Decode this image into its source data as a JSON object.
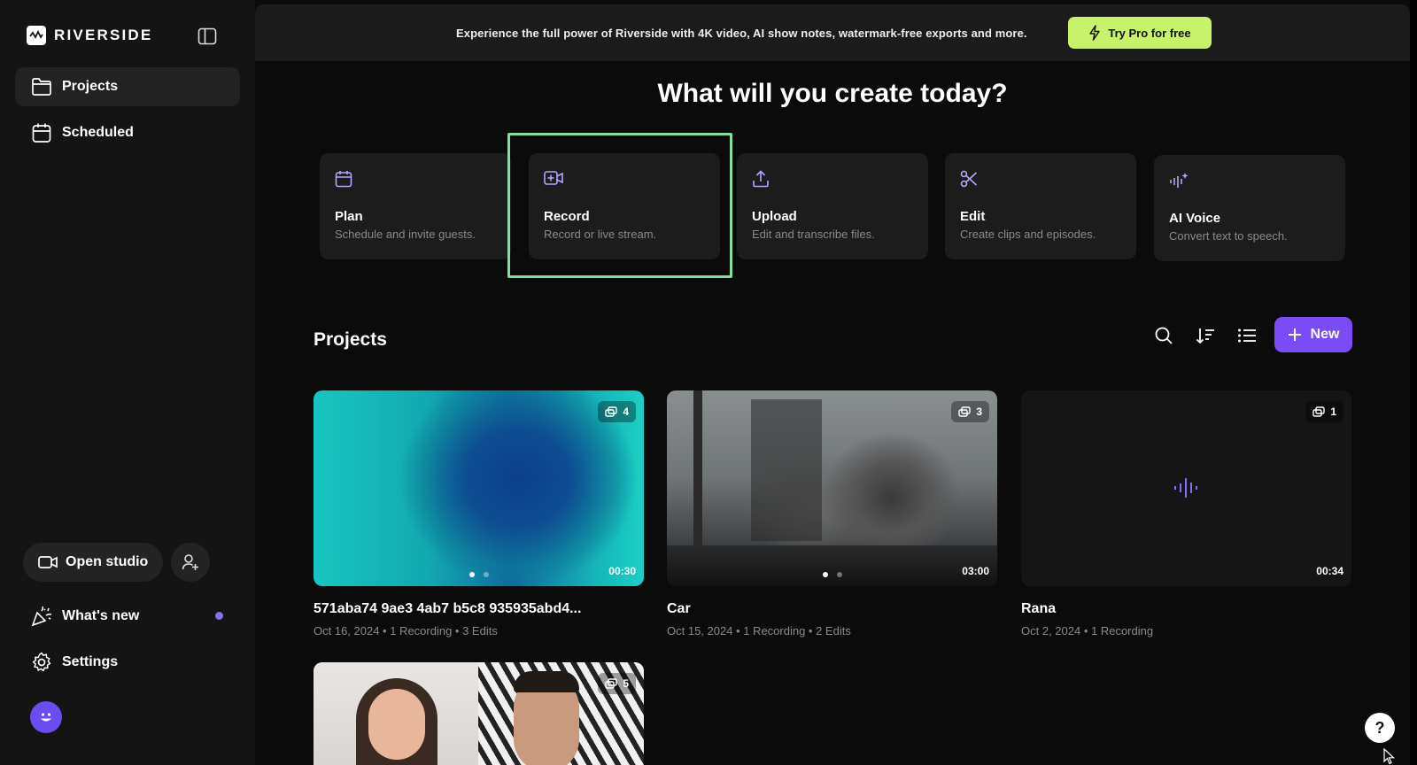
{
  "app": {
    "brand": "RIVERSIDE"
  },
  "sidebar": {
    "items": [
      {
        "label": "Projects",
        "icon": "folder-icon",
        "active": true
      },
      {
        "label": "Scheduled",
        "icon": "calendar-icon",
        "active": false
      }
    ],
    "open_studio": "Open studio",
    "whats_new": "What's new",
    "settings": "Settings"
  },
  "banner": {
    "text": "Experience the full power of Riverside with 4K video, AI show notes, watermark-free exports and more.",
    "cta": "Try Pro for free"
  },
  "headline": "What will you create today?",
  "actions": [
    {
      "title": "Plan",
      "desc": "Schedule and invite guests.",
      "icon": "calendar-icon"
    },
    {
      "title": "Record",
      "desc": "Record or live stream.",
      "icon": "video-plus-icon"
    },
    {
      "title": "Upload",
      "desc": "Edit and transcribe files.",
      "icon": "upload-icon"
    },
    {
      "title": "Edit",
      "desc": "Create clips and episodes.",
      "icon": "scissors-icon"
    },
    {
      "title": "AI Voice",
      "desc": "Convert text to speech.",
      "icon": "ai-voice-icon"
    }
  ],
  "projects": {
    "title": "Projects",
    "new_label": "New",
    "items": [
      {
        "name": "571aba74 9ae3 4ab7 b5c8 935935abd4...",
        "meta": "Oct 16, 2024 • 1 Recording • 3 Edits",
        "count": "4",
        "duration": "00:30"
      },
      {
        "name": "Car",
        "meta": "Oct 15, 2024 • 1 Recording • 2 Edits",
        "count": "3",
        "duration": "03:00"
      },
      {
        "name": "Rana",
        "meta": "Oct 2, 2024 • 1 Recording",
        "count": "1",
        "duration": "00:34"
      },
      {
        "name": "",
        "meta": "",
        "count": "5",
        "duration": ""
      }
    ]
  },
  "help": "?",
  "colors": {
    "accent": "#7b4cf5",
    "pro": "#c7f26b",
    "highlight": "#7fe0a0"
  }
}
